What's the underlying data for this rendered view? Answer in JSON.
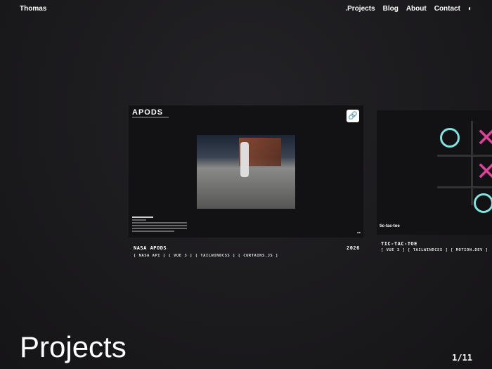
{
  "nav": {
    "brand": "Thomas",
    "links": [
      ".Projects",
      "Blog",
      "About",
      "Contact"
    ],
    "theme_icon": "moon-icon"
  },
  "projects": [
    {
      "card_title": "APODS",
      "name": "NASA APODS",
      "year": "2026",
      "tags": [
        "[ NASA API ]",
        "[ VUE 3 ]",
        "[ TAILWINDCSS ]",
        "[ CURTAINS.JS ]"
      ]
    },
    {
      "card_title": "tic-tac-toe",
      "name": "TIC-TAC-TOE",
      "tags": [
        "[ VUE 3 ]",
        "[ TAILWINDCSS ]",
        "[ MOTION.DEV ]"
      ]
    }
  ],
  "heading": "Projects",
  "pager": "1/11"
}
